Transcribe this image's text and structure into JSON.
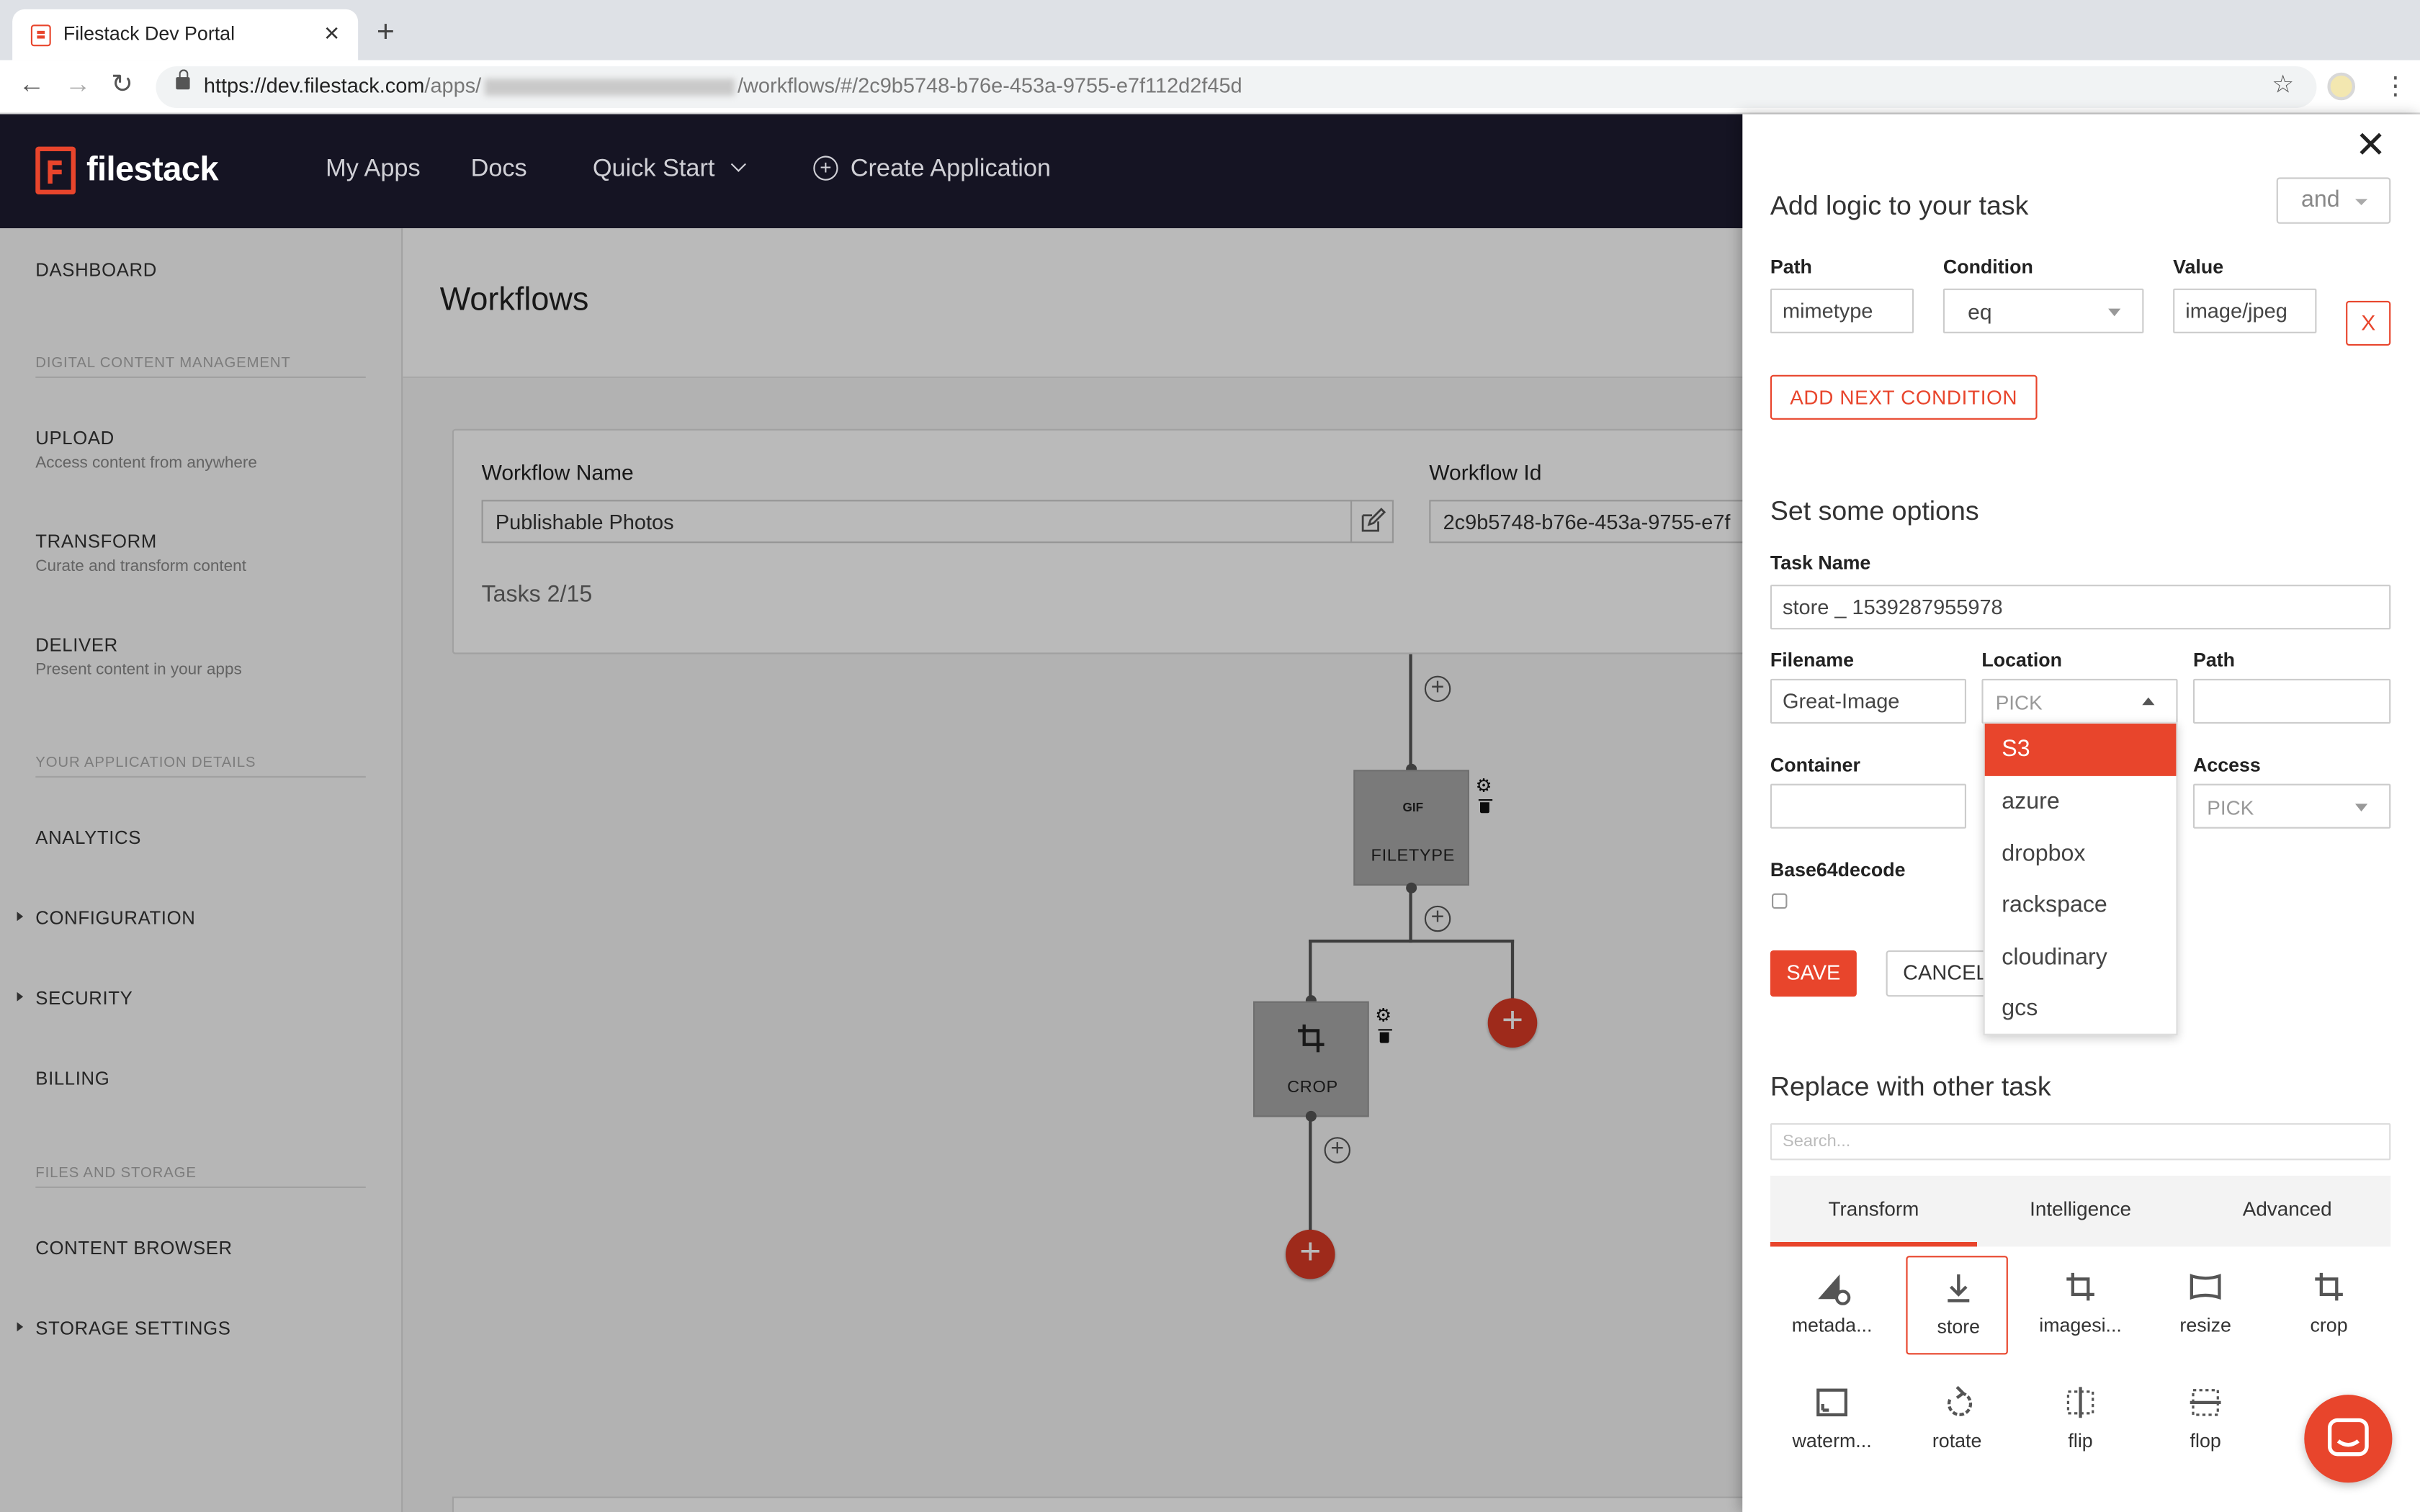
{
  "browser": {
    "tab_title": "Filestack Dev Portal",
    "url_prefix": "https://dev.filestack.com",
    "url_mid": "/apps/",
    "url_suffix": "/workflows/#/2c9b5748-b76e-453a-9755-e7f112d2f45d"
  },
  "header": {
    "logo": "filestack",
    "nav": [
      "My Apps",
      "Docs",
      "Quick Start",
      "Create Application"
    ]
  },
  "sidebar": {
    "dashboard": "DASHBOARD",
    "section1": "DIGITAL CONTENT MANAGEMENT",
    "upload": "UPLOAD",
    "upload_sub": "Access content from anywhere",
    "transform": "TRANSFORM",
    "transform_sub": "Curate and transform content",
    "deliver": "DELIVER",
    "deliver_sub": "Present content in your apps",
    "section2": "YOUR APPLICATION DETAILS",
    "analytics": "ANALYTICS",
    "configuration": "CONFIGURATION",
    "security": "SECURITY",
    "billing": "BILLING",
    "section3": "FILES AND STORAGE",
    "content_browser": "CONTENT BROWSER",
    "storage_settings": "STORAGE SETTINGS"
  },
  "main": {
    "title": "Workflows",
    "workflow_name_label": "Workflow Name",
    "workflow_name": "Publishable Photos",
    "workflow_id_label": "Workflow Id",
    "workflow_id": "2c9b5748-b76e-453a-9755-e7f",
    "tasks": "Tasks 2/15"
  },
  "flow": {
    "node1_icon": "GIF",
    "node1_label": "FILETYPE",
    "node2_label": "CROP"
  },
  "panel": {
    "logic_title": "Add logic to your task",
    "logic_op": "and",
    "path_label": "Path",
    "condition_label": "Condition",
    "value_label": "Value",
    "path_value": "mimetype",
    "condition_value": "eq",
    "value_value": "image/jpeg",
    "remove_label": "X",
    "add_condition": "ADD NEXT CONDITION",
    "options_title": "Set some options",
    "task_name_label": "Task Name",
    "task_name": "store _ 1539287955978",
    "filename_label": "Filename",
    "filename": "Great-Image",
    "location_label": "Location",
    "location_placeholder": "PICK",
    "path2_label": "Path",
    "path2_value": "",
    "container_label": "Container",
    "container_value": "",
    "access_label": "Access",
    "access_placeholder": "PICK",
    "base64_label": "Base64decode",
    "save": "SAVE",
    "cancel": "CANCEL",
    "location_options": [
      "S3",
      "azure",
      "dropbox",
      "rackspace",
      "cloudinary",
      "gcs"
    ],
    "location_selected": "S3",
    "replace_title": "Replace with other task",
    "search_placeholder": "Search...",
    "tabs": [
      "Transform",
      "Intelligence",
      "Advanced"
    ],
    "active_tab": "Transform",
    "tiles": [
      {
        "label": "metada...",
        "icon": "metadata-icon"
      },
      {
        "label": "store",
        "icon": "store-icon"
      },
      {
        "label": "imagesi...",
        "icon": "imagesize-icon"
      },
      {
        "label": "resize",
        "icon": "resize-icon"
      },
      {
        "label": "crop",
        "icon": "crop-icon"
      },
      {
        "label": "waterm...",
        "icon": "watermark-icon"
      },
      {
        "label": "rotate",
        "icon": "rotate-icon"
      },
      {
        "label": "flip",
        "icon": "flip-icon"
      },
      {
        "label": "flop",
        "icon": "flop-icon"
      }
    ],
    "active_tile": "store"
  },
  "colors": {
    "accent": "#e8452c",
    "header_bg": "#151423"
  }
}
